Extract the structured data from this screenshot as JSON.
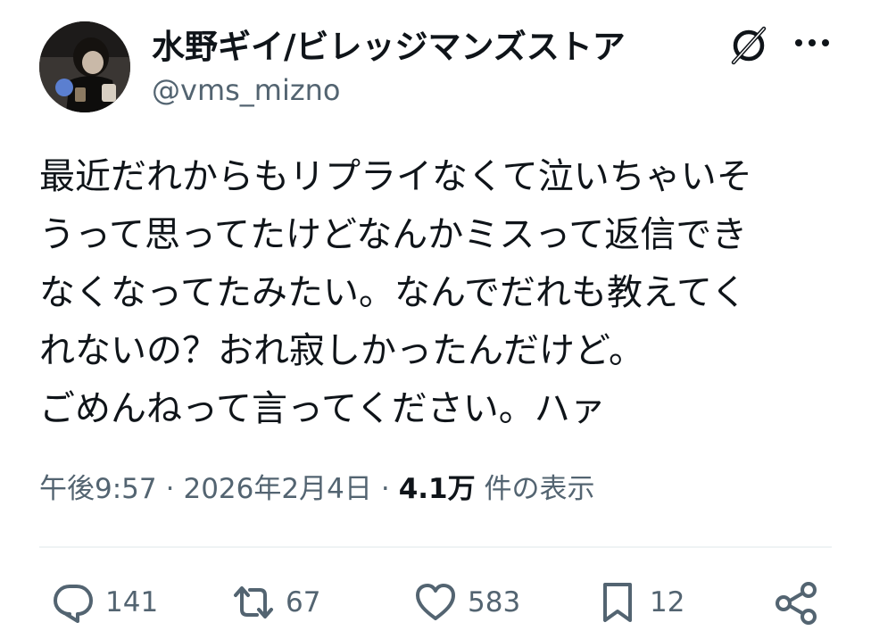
{
  "author": {
    "display_name": "水野ギイ/ビレッジマンズストア",
    "handle": "@vms_mizno",
    "avatar_icon": "avatar-photo"
  },
  "header_icons": [
    "grok-icon",
    "more-icon"
  ],
  "tweet": {
    "text": "最近だれからもリプライなくて泣いちゃいそ\nうって思ってたけどなんかミスって返信でき\nなくなってたみたい。なんでだれも教えてく\nれないの？おれ寂しかったんだけど。\nごめんねって言ってください。ハァ"
  },
  "meta": {
    "time": "午後9:57",
    "date": "2026年2月4日",
    "views_count": "4.1万",
    "views_label": "件の表示",
    "separator": "·"
  },
  "actions": {
    "replies": "141",
    "retweets": "67",
    "likes": "583",
    "bookmarks": "12"
  },
  "colors": {
    "text": "#0f1419",
    "secondary": "#536471",
    "divider": "#eff3f4"
  }
}
